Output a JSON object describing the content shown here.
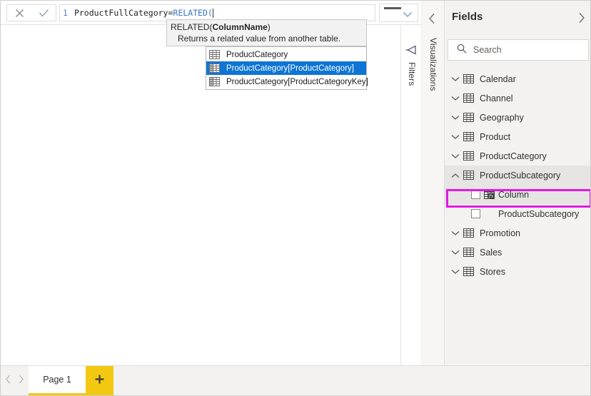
{
  "formula_bar": {
    "cancel_icon": "close-icon",
    "accept_icon": "checkmark-icon",
    "line_number": "1",
    "expression_plain_prefix": "ProductFullCategory=",
    "expression_function": "RELATED(",
    "expression_full": "ProductFullCategory=RELATED(",
    "expander_chevron_icon": "chevron-down-icon",
    "collapse_bar_icon": "minimize-icon"
  },
  "tooltip": {
    "signature_prefix": "RELATED(",
    "signature_param": "ColumnName",
    "signature_suffix": ")",
    "description": "Returns a related value from another table."
  },
  "autocomplete": {
    "items": [
      {
        "label": "ProductCategory",
        "icon": "table-icon",
        "selected": false
      },
      {
        "label": "ProductCategory[ProductCategory]",
        "icon": "column-icon",
        "selected": true
      },
      {
        "label": "ProductCategory[ProductCategoryKey]",
        "icon": "column-icon",
        "selected": false
      }
    ]
  },
  "rails": {
    "filters": {
      "label": "Filters",
      "icon": "filter-funnel-icon"
    },
    "visualizations": {
      "label": "Visualizations",
      "icon": "chevron-left-icon"
    }
  },
  "fields_panel": {
    "title": "Fields",
    "collapse_icon": "chevron-left-icon",
    "expand_icon": "chevron-right-icon",
    "search": {
      "placeholder": "Search",
      "value": "",
      "icon": "search-icon"
    },
    "tree": [
      {
        "type": "table",
        "label": "Calendar",
        "icon": "table-icon",
        "chevron": "chevron-down-icon",
        "expanded": false,
        "highlighted": false
      },
      {
        "type": "table",
        "label": "Channel",
        "icon": "table-icon",
        "chevron": "chevron-down-icon",
        "expanded": false,
        "highlighted": false
      },
      {
        "type": "table",
        "label": "Geography",
        "icon": "table-icon",
        "chevron": "chevron-down-icon",
        "expanded": false,
        "highlighted": false
      },
      {
        "type": "table",
        "label": "Product",
        "icon": "table-icon",
        "chevron": "chevron-down-icon",
        "expanded": false,
        "highlighted": false
      },
      {
        "type": "table",
        "label": "ProductCategory",
        "icon": "table-icon",
        "chevron": "chevron-down-icon",
        "expanded": false,
        "highlighted": false
      },
      {
        "type": "table",
        "label": "ProductSubcategory",
        "icon": "table-icon",
        "chevron": "chevron-up-icon",
        "expanded": true,
        "highlighted": true
      },
      {
        "type": "field",
        "label": "Column",
        "icon": "calculated-column-icon",
        "checked": false,
        "highlighted": true,
        "annotated": true
      },
      {
        "type": "field",
        "label": "ProductSubcategory",
        "icon": "none",
        "checked": false,
        "highlighted": false,
        "annotated": false
      },
      {
        "type": "table",
        "label": "Promotion",
        "icon": "table-icon",
        "chevron": "chevron-down-icon",
        "expanded": false,
        "highlighted": false
      },
      {
        "type": "table",
        "label": "Sales",
        "icon": "table-icon",
        "chevron": "chevron-down-icon",
        "expanded": false,
        "highlighted": false
      },
      {
        "type": "table",
        "label": "Stores",
        "icon": "table-icon",
        "chevron": "chevron-down-icon",
        "expanded": false,
        "highlighted": false
      }
    ]
  },
  "page_bar": {
    "prev_icon": "chevron-left-icon",
    "next_icon": "chevron-right-icon",
    "tabs": [
      {
        "label": "Page 1",
        "active": true
      }
    ],
    "add_label": "+",
    "add_icon": "plus-icon"
  },
  "colors": {
    "accent_yellow": "#f2c811",
    "selection_blue": "#0f75d4",
    "annotation_magenta": "#e318e3",
    "panel_gray": "#f3f2f1",
    "formula_function_blue": "#3a73c8"
  }
}
